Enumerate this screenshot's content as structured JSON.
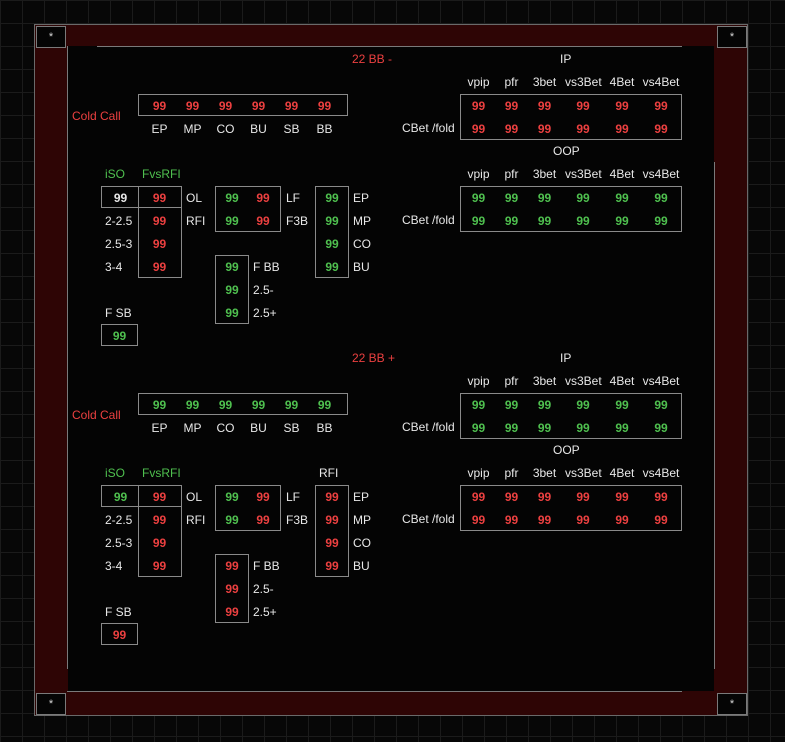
{
  "colors": {
    "red": "#ec4040",
    "green": "#4fc04f",
    "frame": "#2e0505",
    "background": "#070707"
  },
  "corner_mark": "*",
  "positions": [
    "EP",
    "MP",
    "CO",
    "BU",
    "SB",
    "BB"
  ],
  "stat_headers": [
    "vpip",
    "pfr",
    "3bet",
    "vs3Bet",
    "4Bet",
    "vs4Bet"
  ],
  "ip_label": "IP",
  "oop_label": "OOP",
  "cbet_label": "CBet /fold",
  "cold_call_label": "Cold Call",
  "iso_label": "iSO",
  "fvsrfi_label": "FvsRFI",
  "rfi_label": "RFI",
  "fsb_label": "F SB",
  "row_labels": [
    "2-2.5",
    "2.5-3",
    "3-4"
  ],
  "ol_label": "OL",
  "rfi_row_label": "RFI",
  "lf_label": "LF",
  "f3b_label": "F3B",
  "fbb_labels": [
    "F BB",
    "2.5-",
    "2.5+"
  ],
  "vs_pos_labels": [
    "EP",
    "MP",
    "CO",
    "BU"
  ],
  "sections": [
    {
      "title": "22 BB -",
      "cold_call": {
        "values": [
          "99",
          "99",
          "99",
          "99",
          "99",
          "99"
        ],
        "color": "red"
      },
      "ip": {
        "rows": [
          [
            "99",
            "99",
            "99",
            "99",
            "99",
            "99"
          ],
          [
            "99",
            "99",
            "99",
            "99",
            "99",
            "99"
          ]
        ],
        "color": "red"
      },
      "oop": {
        "rows": [
          [
            "99",
            "99",
            "99",
            "99",
            "99",
            "99"
          ],
          [
            "99",
            "99",
            "99",
            "99",
            "99",
            "99"
          ]
        ],
        "color": "green"
      },
      "show_rfi_header": false,
      "iso": {
        "first": "99",
        "first_color": "white",
        "fvsrfi": [
          "99",
          "99",
          "99",
          "99"
        ],
        "fvsrfi_color": "red"
      },
      "ol_lf": {
        "rows": [
          [
            "99",
            "99"
          ],
          [
            "99",
            "99"
          ]
        ],
        "colors": [
          "green",
          "red"
        ]
      },
      "vs_pos": {
        "values": [
          "99",
          "99",
          "99",
          "99"
        ],
        "color": "green"
      },
      "fbb": {
        "values": [
          "99",
          "99",
          "99"
        ],
        "color": "green"
      },
      "fsb": {
        "value": "99",
        "color": "green"
      }
    },
    {
      "title": "22 BB +",
      "cold_call": {
        "values": [
          "99",
          "99",
          "99",
          "99",
          "99",
          "99"
        ],
        "color": "green"
      },
      "ip": {
        "rows": [
          [
            "99",
            "99",
            "99",
            "99",
            "99",
            "99"
          ],
          [
            "99",
            "99",
            "99",
            "99",
            "99",
            "99"
          ]
        ],
        "color": "green"
      },
      "oop": {
        "rows": [
          [
            "99",
            "99",
            "99",
            "99",
            "99",
            "99"
          ],
          [
            "99",
            "99",
            "99",
            "99",
            "99",
            "99"
          ]
        ],
        "color": "red"
      },
      "show_rfi_header": true,
      "iso": {
        "first": "99",
        "first_color": "green",
        "fvsrfi": [
          "99",
          "99",
          "99",
          "99"
        ],
        "fvsrfi_color": "red"
      },
      "ol_lf": {
        "rows": [
          [
            "99",
            "99"
          ],
          [
            "99",
            "99"
          ]
        ],
        "colors": [
          "green",
          "red"
        ]
      },
      "vs_pos": {
        "values": [
          "99",
          "99",
          "99",
          "99"
        ],
        "color": "red"
      },
      "fbb": {
        "values": [
          "99",
          "99",
          "99"
        ],
        "color": "red"
      },
      "fsb": {
        "value": "99",
        "color": "red"
      }
    }
  ]
}
